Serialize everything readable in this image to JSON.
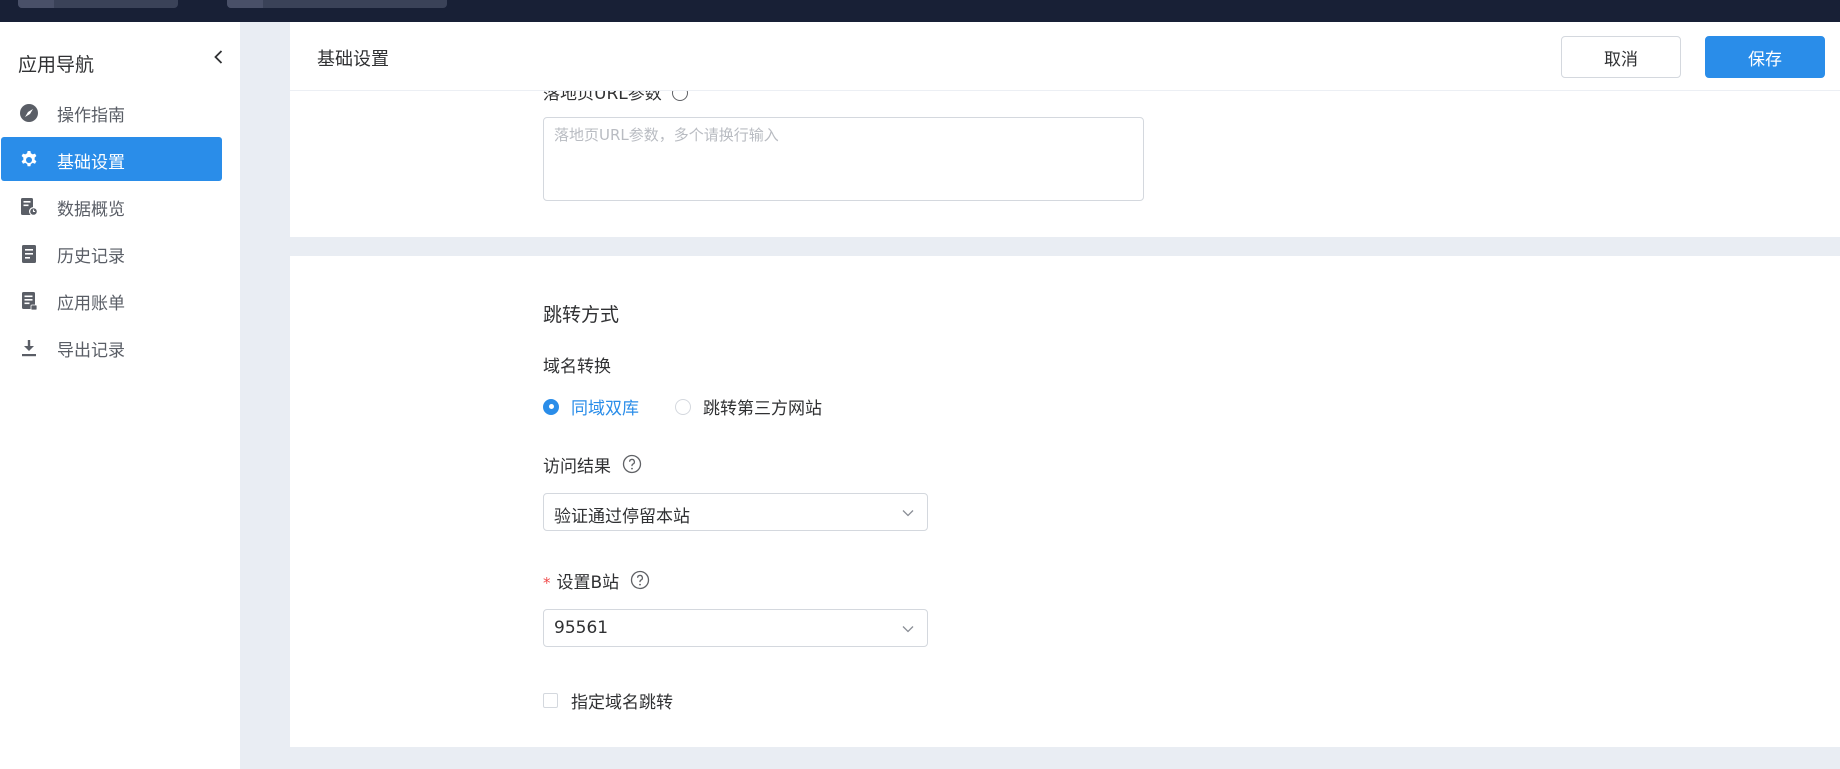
{
  "sidebar": {
    "title": "应用导航",
    "items": [
      {
        "label": "操作指南",
        "icon": "compass-icon"
      },
      {
        "label": "基础设置",
        "icon": "gear-icon",
        "active": true
      },
      {
        "label": "数据概览",
        "icon": "data-report-icon"
      },
      {
        "label": "历史记录",
        "icon": "document-icon"
      },
      {
        "label": "应用账单",
        "icon": "bill-icon"
      },
      {
        "label": "导出记录",
        "icon": "download-icon"
      }
    ]
  },
  "header": {
    "title": "基础设置",
    "cancel_label": "取消",
    "save_label": "保存"
  },
  "url_params": {
    "label": "落地页URL参数",
    "placeholder": "落地页URL参数，多个请换行输入",
    "value": ""
  },
  "redirect": {
    "section_title": "跳转方式",
    "domain_label": "域名转换",
    "options": [
      "同域双库",
      "跳转第三方网站"
    ],
    "selected_option": "同域双库",
    "visit_result_label": "访问结果",
    "visit_result_value": "验证通过停留本站",
    "b_site_required_mark": "*",
    "b_site_label": "设置B站",
    "b_site_value": "95561",
    "specify_domain_label": "指定域名跳转"
  },
  "colors": {
    "accent": "#2a8de9",
    "topbar": "#182036",
    "required": "#f04a4a"
  }
}
